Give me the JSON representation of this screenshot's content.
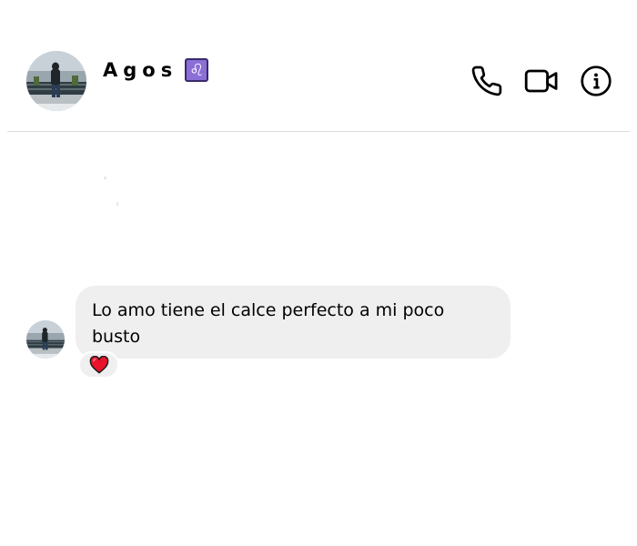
{
  "header": {
    "contact_name": "Agos",
    "zodiac_badge": "♌",
    "call_icon": "phone-icon",
    "video_icon": "video-camera-icon",
    "info_icon": "info-icon"
  },
  "thread": {
    "messages": [
      {
        "sender": "Agos",
        "text": "Lo amo tiene el calce perfecto a mi poco busto",
        "reaction": "❤️"
      }
    ]
  },
  "colors": {
    "bubble_bg": "#efefef",
    "divider": "#dbdbdb",
    "heart": "#e8132b",
    "zodiac_badge": "#8b6fd6"
  }
}
